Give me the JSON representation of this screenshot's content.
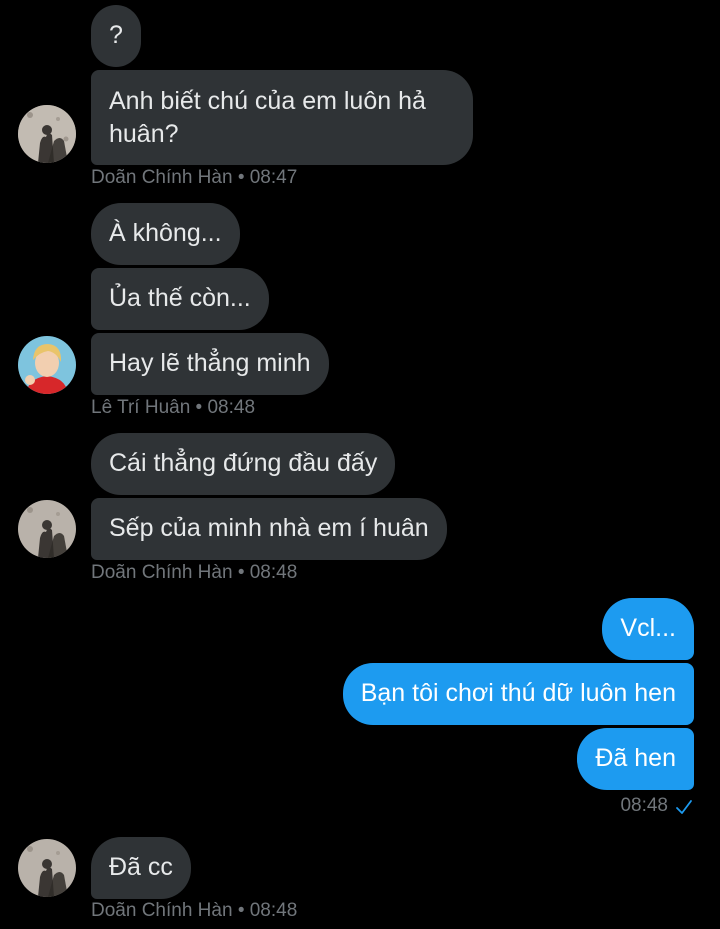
{
  "messages": {
    "m1": "?",
    "m2": "Anh biết chú của em luôn hả huân?",
    "m3": "À không...",
    "m4": "Ủa thế còn...",
    "m5": "Hay lẽ thẳng minh",
    "m6": "Cái thẳng đứng đầu đấy",
    "m7": "Sếp của minh nhà em í huân",
    "m8": "Vcl...",
    "m9": "Bạn tôi chơi thú dữ luôn hen",
    "m10": "Đã hen",
    "m11": "Đã cc"
  },
  "meta": {
    "g1": "Doãn Chính Hàn • 08:47",
    "g2": "Lê Trí Huân • 08:48",
    "g3": "Doãn Chính Hàn • 08:48",
    "g4_time": "08:48",
    "g5": "Doãn Chính Hàn • 08:48"
  },
  "icons": {
    "read_receipt": "check-icon",
    "avatar_doan": "avatar-doan-chinh-han",
    "avatar_le": "avatar-le-tri-huan"
  },
  "colors": {
    "background": "#000000",
    "incoming_bubble": "#2f3336",
    "outgoing_bubble": "#1d9bf0",
    "meta_text": "#71767b",
    "message_text": "#e7e9ea"
  }
}
